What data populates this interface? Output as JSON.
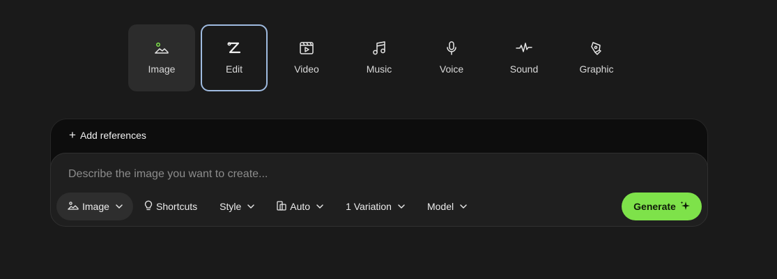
{
  "modes": [
    {
      "label": "Image",
      "icon": "image-icon"
    },
    {
      "label": "Edit",
      "icon": "edit-icon"
    },
    {
      "label": "Video",
      "icon": "video-icon"
    },
    {
      "label": "Music",
      "icon": "music-icon"
    },
    {
      "label": "Voice",
      "icon": "microphone-icon"
    },
    {
      "label": "Sound",
      "icon": "sound-wave-icon"
    },
    {
      "label": "Graphic",
      "icon": "pen-nib-icon"
    }
  ],
  "panel": {
    "add_references": "Add references",
    "prompt_placeholder": "Describe the image you want to create...",
    "toolbar": {
      "type": "Image",
      "shortcuts": "Shortcuts",
      "style": "Style",
      "aspect": "Auto",
      "variations": "1 Variation",
      "model": "Model"
    },
    "generate": "Generate"
  },
  "colors": {
    "background": "#1a1a1a",
    "accent_green": "#7ee24a",
    "selected_border": "#9fbbe0"
  }
}
